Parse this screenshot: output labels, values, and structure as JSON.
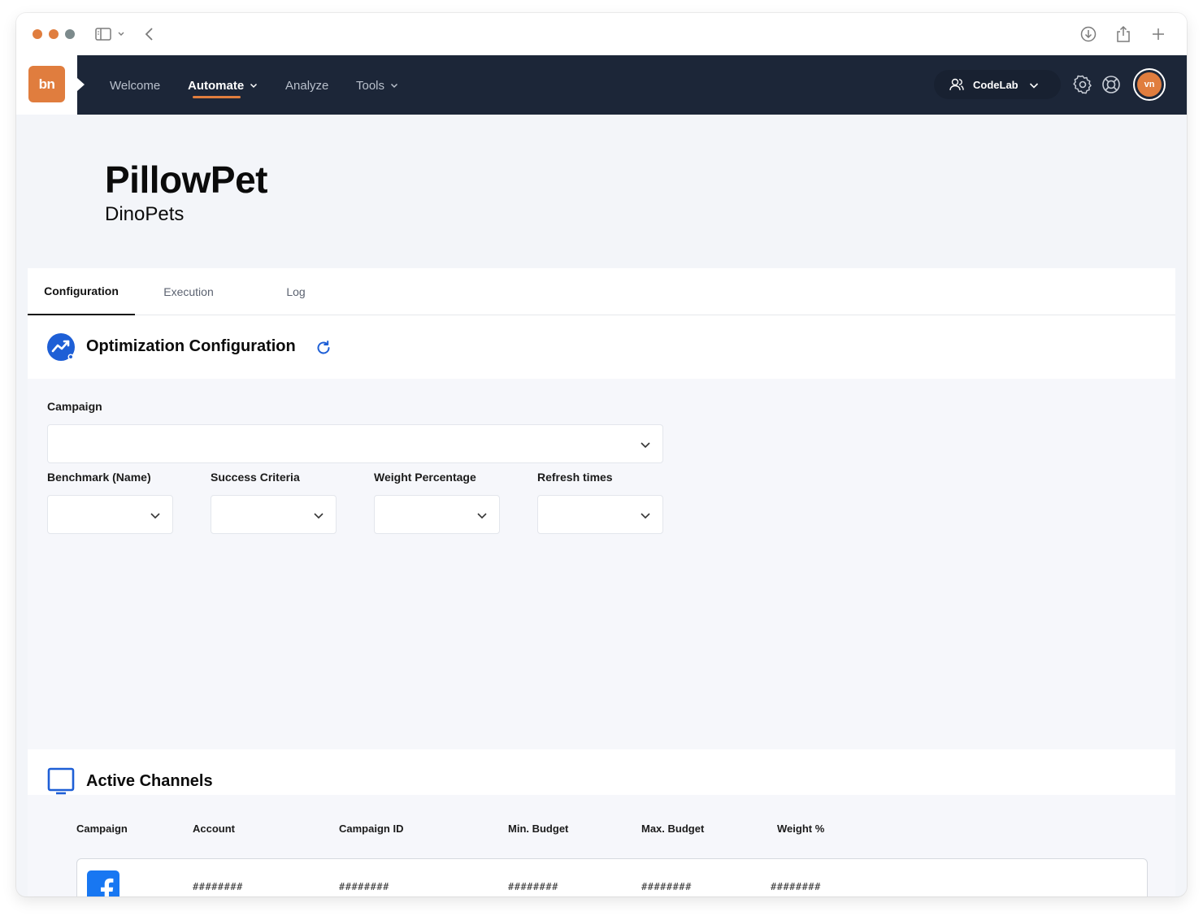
{
  "browser": {
    "traffic_colors": [
      "#e07d3e",
      "#e07d3e",
      "#7c8a8c"
    ]
  },
  "nav": {
    "logo_text": "bn",
    "items": [
      {
        "label": "Welcome",
        "has_caret": false,
        "active": false
      },
      {
        "label": "Automate",
        "has_caret": true,
        "active": true
      },
      {
        "label": "Analyze",
        "has_caret": false,
        "active": false
      },
      {
        "label": "Tools",
        "has_caret": true,
        "active": false
      }
    ],
    "org": "CodeLab",
    "avatar_initials": "vn",
    "icons": [
      "users-icon",
      "chevron-down-icon",
      "gear-icon",
      "lifebuoy-icon"
    ],
    "accent": "#e07d3e",
    "background": "#1c2638"
  },
  "page": {
    "title": "PillowPet",
    "subtitle": "DinoPets"
  },
  "tabs": [
    {
      "label": "Configuration",
      "active": true
    },
    {
      "label": "Execution",
      "active": false
    },
    {
      "label": "Log",
      "active": false
    }
  ],
  "optimization": {
    "title": "Optimization Configuration",
    "icons": [
      "trending-chart-icon",
      "refresh-icon"
    ],
    "campaign_label": "Campaign",
    "campaign_value": "",
    "fields": [
      {
        "label": "Benchmark (Name)",
        "value": ""
      },
      {
        "label": "Success Criteria",
        "value": ""
      },
      {
        "label": "Weight Percentage",
        "value": ""
      },
      {
        "label": "Refresh times",
        "value": ""
      }
    ]
  },
  "channels": {
    "title": "Active Channels",
    "icon": "monitor-icon",
    "columns": [
      "Campaign",
      "Account",
      "Campaign ID",
      "Min. Budget",
      "Max. Budget",
      "Weight %"
    ],
    "rows": [
      {
        "channel_icon": "facebook-icon",
        "account": "########",
        "campaign_id": "########",
        "min_budget": "########",
        "max_budget": "########",
        "weight": "########"
      }
    ]
  }
}
